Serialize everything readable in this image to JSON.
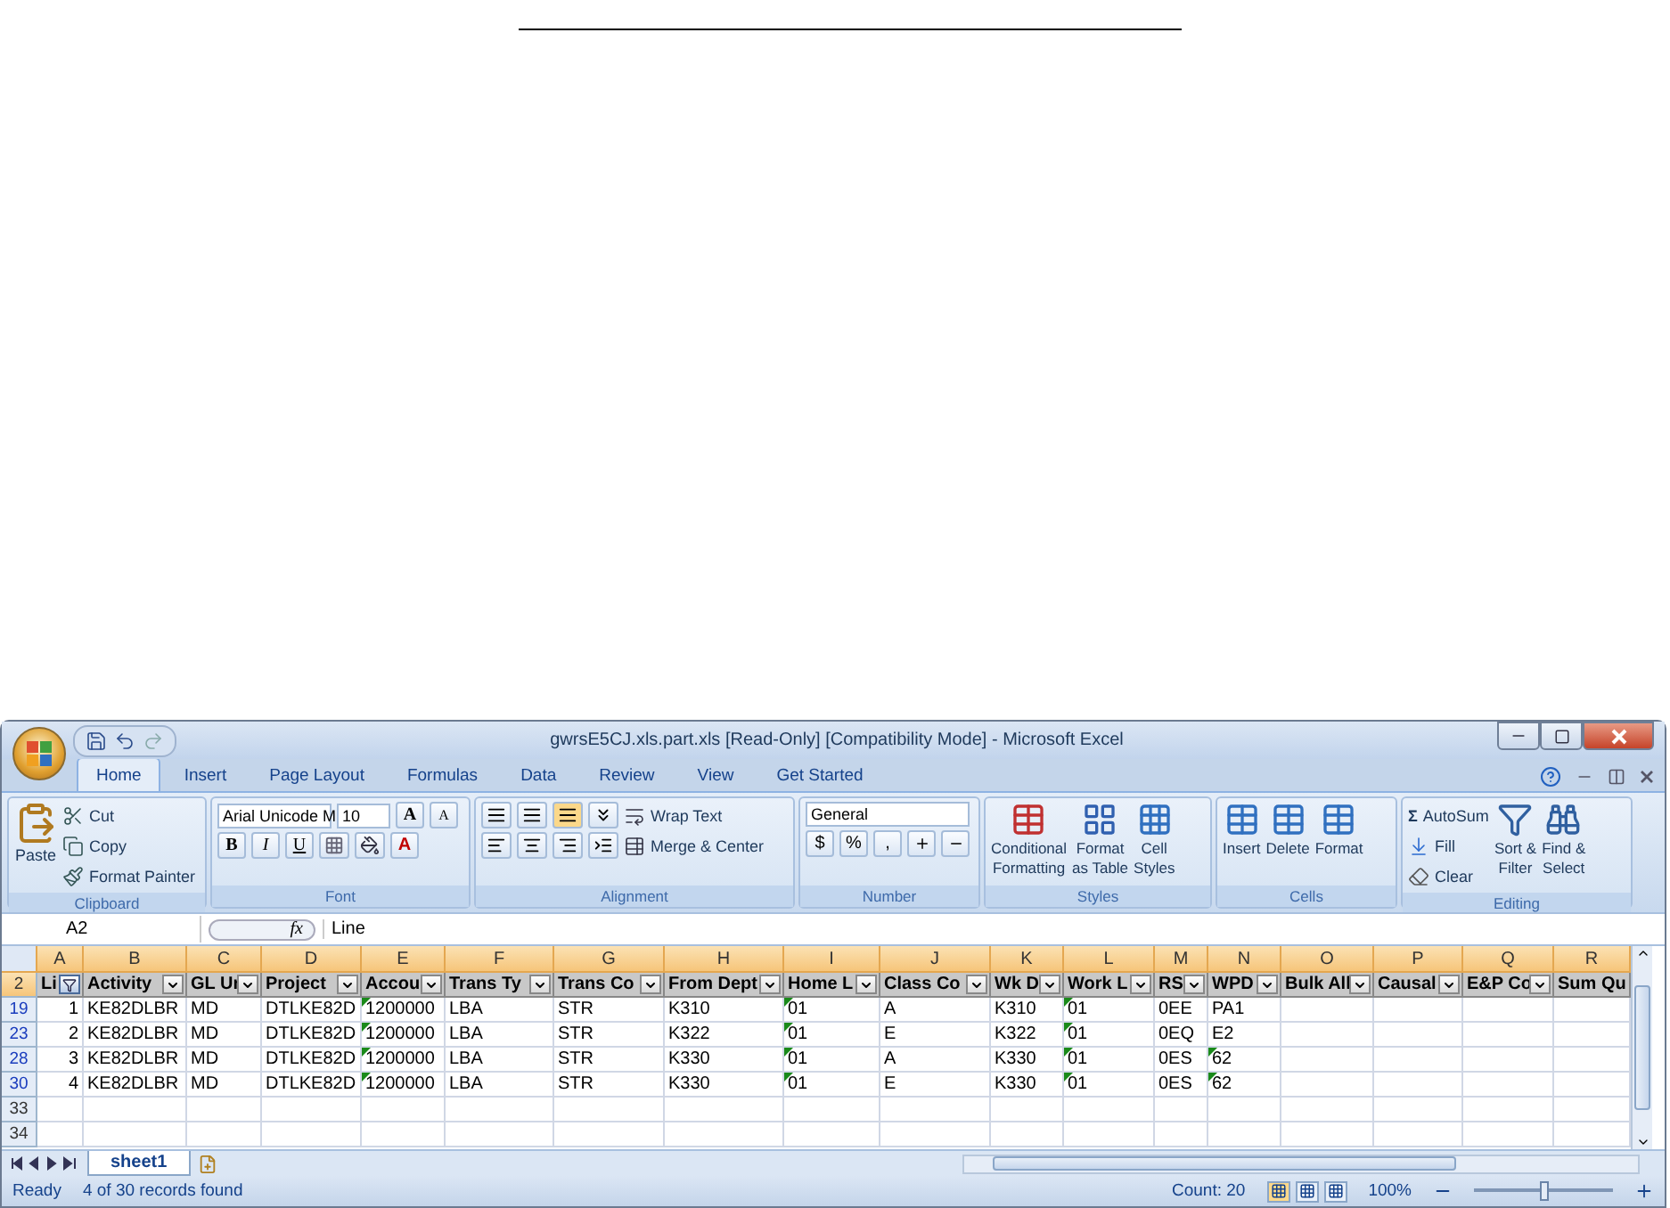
{
  "window": {
    "title": "gwrsE5CJ.xls.part.xls  [Read-Only]  [Compatibility Mode] - Microsoft Excel"
  },
  "tabs": [
    {
      "label": "Home",
      "selected": true
    },
    {
      "label": "Insert",
      "selected": false
    },
    {
      "label": "Page Layout",
      "selected": false
    },
    {
      "label": "Formulas",
      "selected": false
    },
    {
      "label": "Data",
      "selected": false
    },
    {
      "label": "Review",
      "selected": false
    },
    {
      "label": "View",
      "selected": false
    },
    {
      "label": "Get Started",
      "selected": false
    }
  ],
  "ribbon": {
    "clipboard": {
      "title": "Clipboard",
      "paste": "Paste",
      "items": [
        "Cut",
        "Copy",
        "Format Painter"
      ]
    },
    "font": {
      "title": "Font",
      "name": "Arial Unicode M",
      "size": "10",
      "grow": "A",
      "shrink": "A",
      "bold": "B",
      "italic": "I",
      "underline": "U",
      "color_letter": "A"
    },
    "alignment": {
      "title": "Alignment",
      "wrap": "Wrap Text",
      "merge": "Merge & Center"
    },
    "number": {
      "title": "Number",
      "format": "General",
      "currency": "$",
      "percent": "%",
      "comma": ","
    },
    "styles": {
      "title": "Styles",
      "items": [
        [
          "Conditional",
          "Formatting"
        ],
        [
          "Format",
          "as Table"
        ],
        [
          "Cell",
          "Styles"
        ]
      ]
    },
    "cells": {
      "title": "Cells",
      "items": [
        "Insert",
        "Delete",
        "Format"
      ]
    },
    "editing": {
      "title": "Editing",
      "sigma": "Σ",
      "autosum": "AutoSum",
      "fill": "Fill",
      "clear": "Clear",
      "sort": [
        "Sort &",
        "Filter"
      ],
      "find": [
        "Find &",
        "Select"
      ]
    }
  },
  "formula_bar": {
    "name_box": "A2",
    "fx": "fx",
    "formula": "Line"
  },
  "columns": [
    "A",
    "B",
    "C",
    "D",
    "E",
    "F",
    "G",
    "H",
    "I",
    "J",
    "K",
    "L",
    "M",
    "N",
    "O",
    "P",
    "Q",
    "R"
  ],
  "header_row": {
    "number": "2",
    "cells": [
      {
        "text": "Li",
        "filtered": true
      },
      {
        "text": "Activity",
        "filtered": false
      },
      {
        "text": "GL Ur",
        "filtered": false
      },
      {
        "text": "Project",
        "filtered": false
      },
      {
        "text": "Accou",
        "filtered": false
      },
      {
        "text": "Trans Ty",
        "filtered": false
      },
      {
        "text": "Trans Co",
        "filtered": false
      },
      {
        "text": "From Dept",
        "filtered": false
      },
      {
        "text": "Home L",
        "filtered": false
      },
      {
        "text": "Class Co",
        "filtered": false
      },
      {
        "text": "Wk D",
        "filtered": false
      },
      {
        "text": "Work L",
        "filtered": false
      },
      {
        "text": "RS",
        "filtered": false
      },
      {
        "text": "WPD",
        "filtered": false
      },
      {
        "text": "Bulk All",
        "filtered": false
      },
      {
        "text": "Causal",
        "filtered": false
      },
      {
        "text": "E&P Co",
        "filtered": false
      },
      {
        "text": "Sum Qu"
      }
    ]
  },
  "rows": [
    {
      "number": "19",
      "filtered": true,
      "cells": [
        {
          "text": "1",
          "flagged": false
        },
        {
          "text": "KE82DLBR",
          "flagged": false
        },
        {
          "text": "MD",
          "flagged": false
        },
        {
          "text": "DTLKE82D",
          "flagged": false
        },
        {
          "text": "1200000",
          "flagged": true
        },
        {
          "text": "LBA",
          "flagged": false
        },
        {
          "text": "STR",
          "flagged": false
        },
        {
          "text": "K310",
          "flagged": false
        },
        {
          "text": "01",
          "flagged": true
        },
        {
          "text": "A",
          "flagged": false
        },
        {
          "text": "K310",
          "flagged": false
        },
        {
          "text": "01",
          "flagged": true
        },
        {
          "text": "0EE",
          "flagged": false
        },
        {
          "text": "PA1",
          "flagged": false
        }
      ]
    },
    {
      "number": "23",
      "filtered": true,
      "cells": [
        {
          "text": "2",
          "flagged": false
        },
        {
          "text": "KE82DLBR",
          "flagged": false
        },
        {
          "text": "MD",
          "flagged": false
        },
        {
          "text": "DTLKE82D",
          "flagged": false
        },
        {
          "text": "1200000",
          "flagged": true
        },
        {
          "text": "LBA",
          "flagged": false
        },
        {
          "text": "STR",
          "flagged": false
        },
        {
          "text": "K322",
          "flagged": false
        },
        {
          "text": "01",
          "flagged": true
        },
        {
          "text": "E",
          "flagged": false
        },
        {
          "text": "K322",
          "flagged": false
        },
        {
          "text": "01",
          "flagged": true
        },
        {
          "text": "0EQ",
          "flagged": false
        },
        {
          "text": "E2",
          "flagged": false
        }
      ]
    },
    {
      "number": "28",
      "filtered": true,
      "cells": [
        {
          "text": "3",
          "flagged": false
        },
        {
          "text": "KE82DLBR",
          "flagged": false
        },
        {
          "text": "MD",
          "flagged": false
        },
        {
          "text": "DTLKE82D",
          "flagged": false
        },
        {
          "text": "1200000",
          "flagged": true
        },
        {
          "text": "LBA",
          "flagged": false
        },
        {
          "text": "STR",
          "flagged": false
        },
        {
          "text": "K330",
          "flagged": false
        },
        {
          "text": "01",
          "flagged": true
        },
        {
          "text": "A",
          "flagged": false
        },
        {
          "text": "K330",
          "flagged": false
        },
        {
          "text": "01",
          "flagged": true
        },
        {
          "text": "0ES",
          "flagged": false
        },
        {
          "text": "62",
          "flagged": true
        }
      ]
    },
    {
      "number": "30",
      "filtered": true,
      "cells": [
        {
          "text": "4",
          "flagged": false
        },
        {
          "text": "KE82DLBR",
          "flagged": false
        },
        {
          "text": "MD",
          "flagged": false
        },
        {
          "text": "DTLKE82D",
          "flagged": false
        },
        {
          "text": "1200000",
          "flagged": true
        },
        {
          "text": "LBA",
          "flagged": false
        },
        {
          "text": "STR",
          "flagged": false
        },
        {
          "text": "K330",
          "flagged": false
        },
        {
          "text": "01",
          "flagged": true
        },
        {
          "text": "E",
          "flagged": false
        },
        {
          "text": "K330",
          "flagged": false
        },
        {
          "text": "01",
          "flagged": true
        },
        {
          "text": "0ES",
          "flagged": false
        },
        {
          "text": "62",
          "flagged": true
        }
      ]
    },
    {
      "number": "33",
      "filtered": false
    },
    {
      "number": "34",
      "filtered": false
    }
  ],
  "sheet_tabs": [
    {
      "label": "sheet1",
      "selected": true
    }
  ],
  "status_bar": {
    "ready": "Ready",
    "records": "4 of 30 records found",
    "count": "Count: 20",
    "zoom": "100%",
    "zoom_slider": {
      "level": 0.5
    },
    "views": [
      {
        "selected": true
      },
      {
        "selected": false
      },
      {
        "selected": false
      }
    ]
  }
}
